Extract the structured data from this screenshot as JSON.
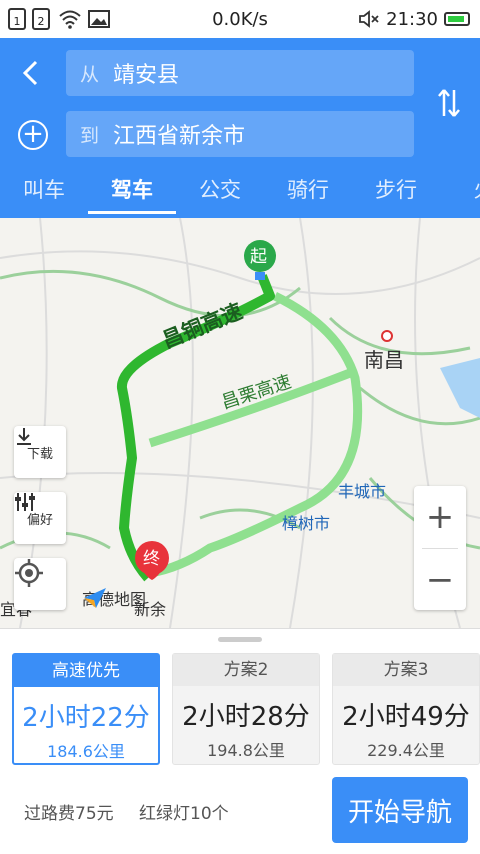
{
  "status": {
    "sim1": "1",
    "sim2": "2",
    "net_speed": "0.0K/s",
    "time": "21:30"
  },
  "route": {
    "from_prefix": "从",
    "from": "靖安县",
    "to_prefix": "到",
    "to": "江西省新余市"
  },
  "tabs": [
    {
      "label": "叫车",
      "active": false
    },
    {
      "label": "驾车",
      "active": true
    },
    {
      "label": "公交",
      "active": false
    },
    {
      "label": "骑行",
      "active": false
    },
    {
      "label": "步行",
      "active": false
    },
    {
      "label": "火",
      "active": false
    }
  ],
  "map": {
    "start_pin": "起",
    "end_pin": "终",
    "roads": {
      "main": "昌铜高速",
      "secondary": "昌栗高速"
    },
    "cities": {
      "nanchang": "南昌",
      "fengcheng": "丰城市",
      "zhangshu": "樟树市",
      "yichun": "宜春",
      "xinyu": "新余"
    },
    "logo": "高德地图",
    "download_label": "下载",
    "prefer_label": "偏好",
    "zoom_in": "+",
    "zoom_out": "−"
  },
  "plans": [
    {
      "name": "高速优先",
      "time": "2小时22分",
      "distance": "184.6公里",
      "active": true
    },
    {
      "name": "方案2",
      "time": "2小时28分",
      "distance": "194.8公里",
      "active": false
    },
    {
      "name": "方案3",
      "time": "2小时49分",
      "distance": "229.4公里",
      "active": false
    }
  ],
  "summary": {
    "toll": "过路费75元",
    "lights": "红绿灯10个"
  },
  "start_nav": "开始导航",
  "colors": {
    "accent": "#3a8ef7",
    "route": "#2fb72f",
    "alt_route": "#8fe08f"
  }
}
